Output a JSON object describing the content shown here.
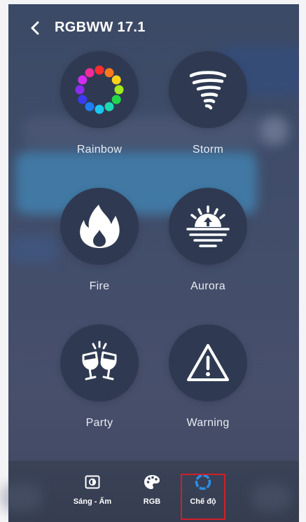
{
  "header": {
    "title": "RGBWW 17.1"
  },
  "modes": [
    {
      "label": "Rainbow",
      "icon": "rainbow-ring-icon"
    },
    {
      "label": "Storm",
      "icon": "tornado-icon"
    },
    {
      "label": "Fire",
      "icon": "fire-icon"
    },
    {
      "label": "Aurora",
      "icon": "sunrise-icon"
    },
    {
      "label": "Party",
      "icon": "cheers-glasses-icon"
    },
    {
      "label": "Warning",
      "icon": "warning-triangle-icon"
    }
  ],
  "bottom_nav": [
    {
      "label": "Sáng - Ấm",
      "icon": "brightness-icon"
    },
    {
      "label": "RGB",
      "icon": "palette-icon"
    },
    {
      "label": "Chế độ",
      "icon": "mode-ring-icon",
      "active": true
    }
  ],
  "colors": {
    "accent": "#2b8fe6",
    "highlight_box": "#d0202a"
  }
}
